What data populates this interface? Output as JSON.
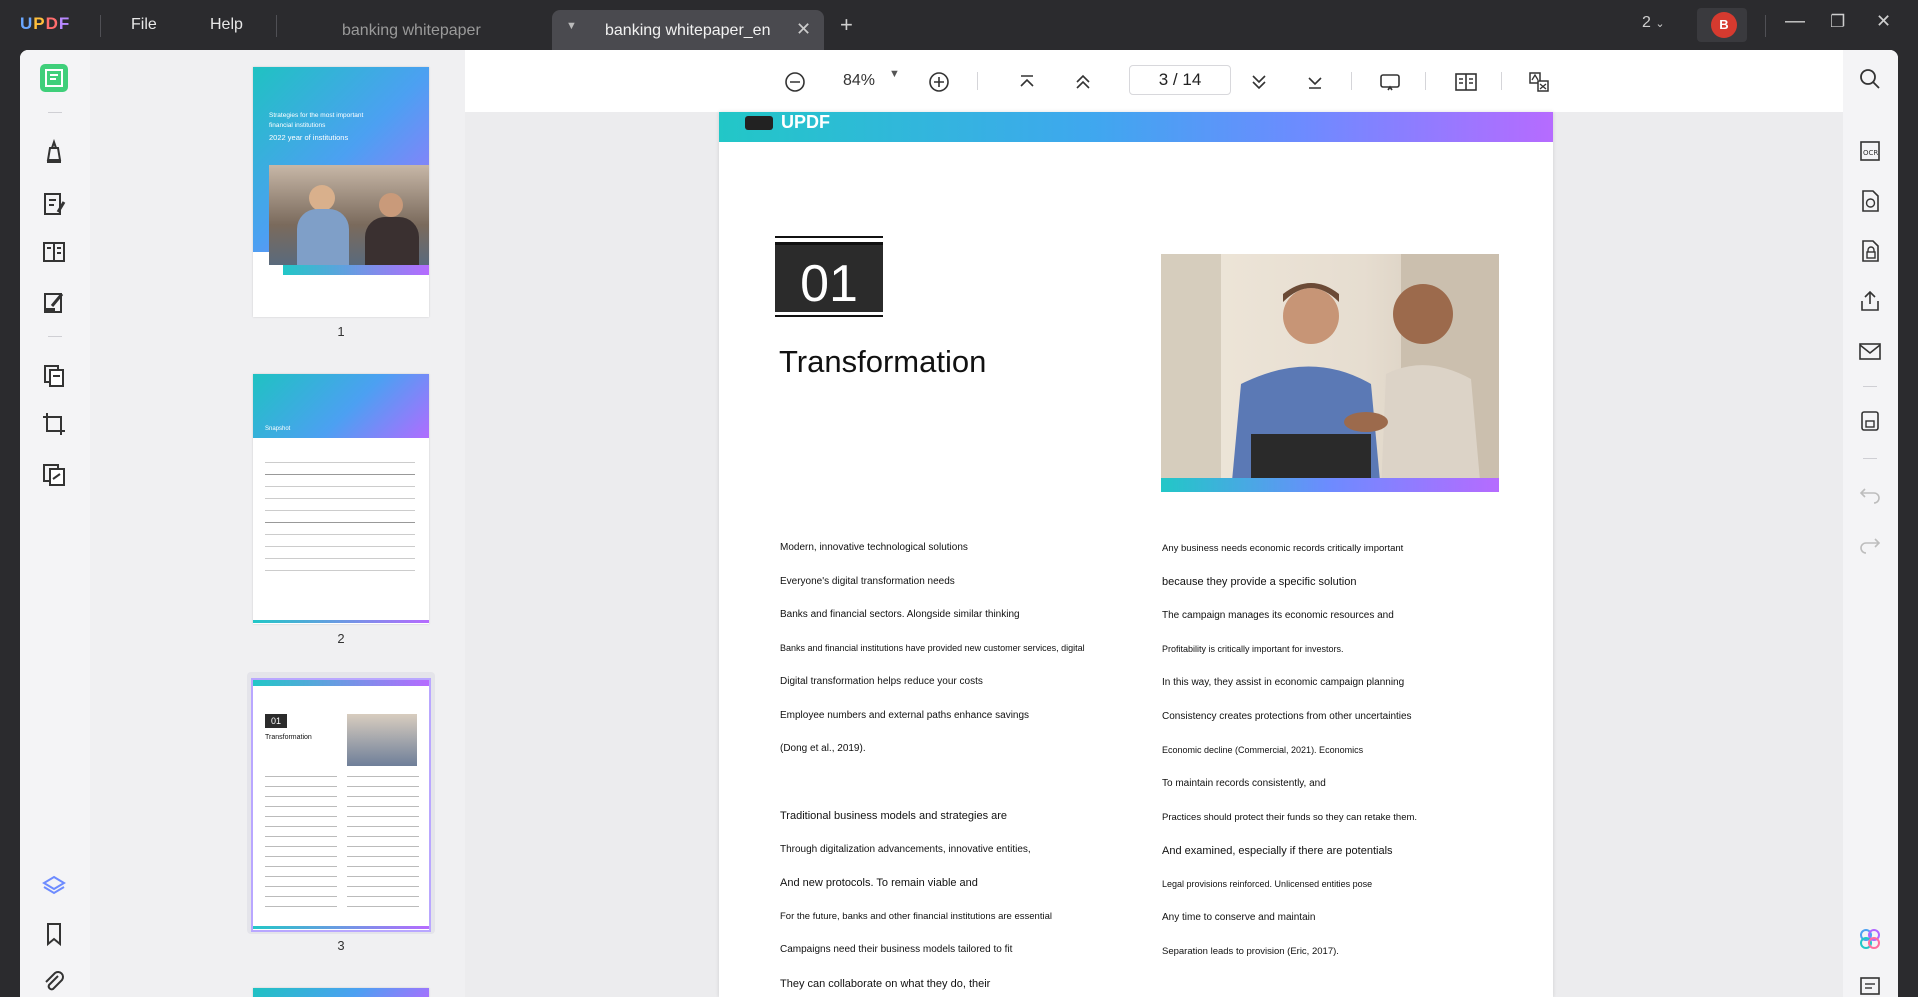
{
  "app": {
    "logo": "UPDF",
    "menu": [
      "File",
      "Help"
    ],
    "tabs": [
      {
        "label": "banking whitepaper",
        "active": false
      },
      {
        "label": "banking whitepaper_en",
        "active": true
      }
    ],
    "window_count": "2",
    "user_initial": "B"
  },
  "toolbar": {
    "zoom": "84%",
    "page_current": "3",
    "page_sep": "/",
    "page_total": "14"
  },
  "thumbnails": [
    {
      "label": "1",
      "title_lines": [
        "Strategies for the most important",
        "financial institutions",
        "2022 year of institutions"
      ]
    },
    {
      "label": "2",
      "title": "Snapshot"
    },
    {
      "label": "3",
      "num": "01",
      "title": "Transformation"
    }
  ],
  "page": {
    "band_logo": "UPDF",
    "number": "01",
    "title": "Transformation",
    "left_col": [
      "Modern, innovative technological solutions",
      "Everyone's digital transformation needs",
      "Banks and financial sectors. Alongside similar thinking",
      "Banks and financial institutions have provided new customer services, digital",
      "Digital transformation helps reduce your costs",
      "Employee numbers and external paths enhance savings",
      "(Dong et al., 2019)."
    ],
    "left_col2": [
      "Traditional business models and strategies are",
      "Through digitalization advancements, innovative entities,",
      "And new protocols. To remain viable and",
      "For the future, banks and other financial institutions are essential",
      "Campaigns need their business models tailored to fit",
      "They can collaborate on what they do, their"
    ],
    "right_col": [
      "Any business needs economic records critically important",
      "because they provide a specific solution",
      "The campaign manages its economic resources and",
      "Profitability is critically important for investors.",
      "In this way, they assist in economic campaign planning",
      "Consistency creates protections from other uncertainties",
      "Economic decline (Commercial, 2021). Economics",
      "To maintain records consistently, and",
      "Practices should protect their funds so they can retake them.",
      "And examined, especially if there are potentials",
      "Legal provisions reinforced. Unlicensed entities pose",
      "Any time to conserve and maintain",
      "Separation leads to provision (Eric, 2017)."
    ]
  },
  "colors": {
    "accent": "#6d8bff",
    "brand_gradient_start": "#22c7c7",
    "brand_gradient_end": "#b66bff",
    "avatar": "#d63a2f"
  },
  "icons": {
    "left_rail": [
      "reader-icon",
      "comment-icon",
      "edit-icon",
      "form-icon",
      "fill-sign-icon",
      "organize-icon",
      "crop-icon",
      "convert-icon",
      "layers-icon",
      "bookmark-icon",
      "attachment-icon"
    ],
    "right_rail": [
      "search-icon",
      "ocr-icon",
      "convert-pdf-icon",
      "protect-icon",
      "share-icon",
      "email-icon",
      "save-icon",
      "undo-icon",
      "redo-icon",
      "ai-icon",
      "comments-list-icon"
    ]
  }
}
